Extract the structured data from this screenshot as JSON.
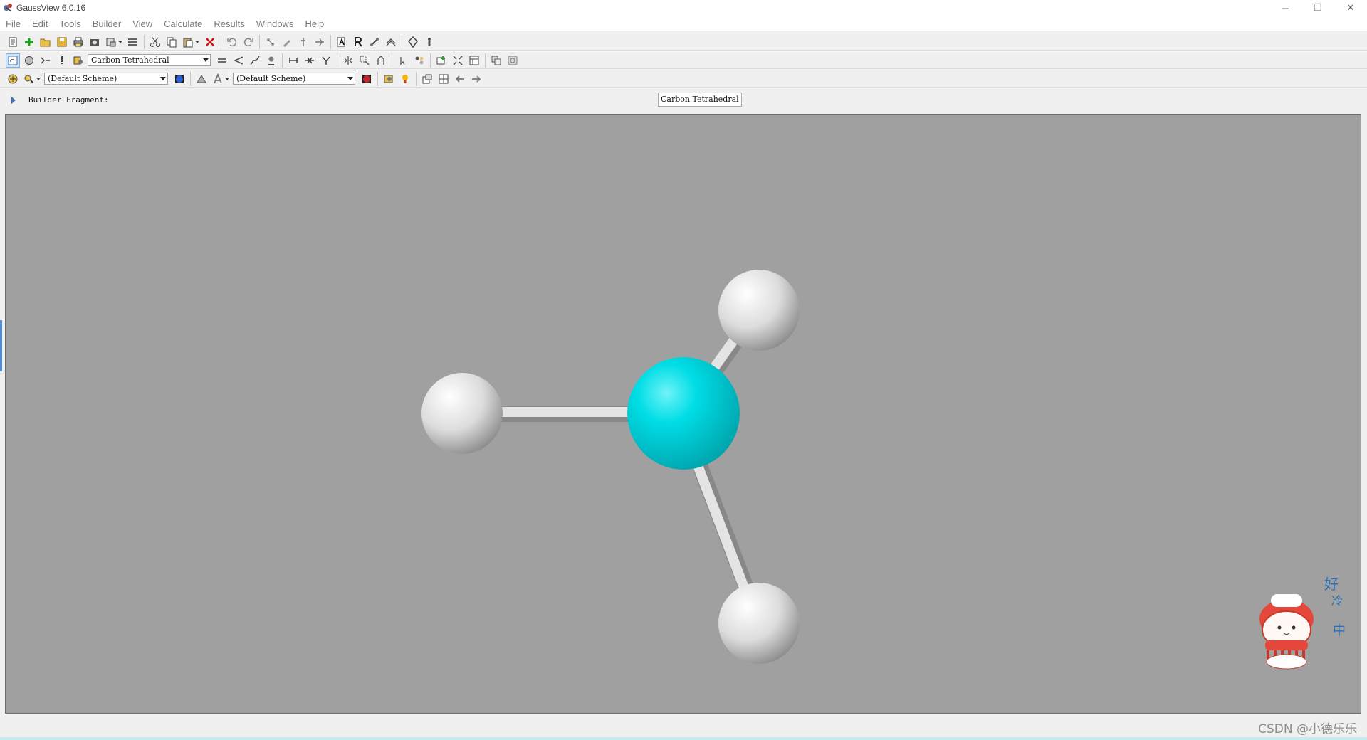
{
  "window": {
    "title": "GaussView 6.0.16",
    "controls": [
      "─",
      "❐",
      "✕"
    ]
  },
  "menu": [
    "File",
    "Edit",
    "Tools",
    "Builder",
    "View",
    "Calculate",
    "Results",
    "Windows",
    "Help"
  ],
  "toolbar2": {
    "fragment_combo": "Carbon Tetrahedral"
  },
  "toolbar3": {
    "scheme_combo_1": "(Default Scheme)",
    "scheme_combo_2": "(Default Scheme)"
  },
  "fragment_bar": {
    "label": "Builder Fragment:",
    "value": "Carbon Tetrahedral"
  },
  "molecule": {
    "central_atom": {
      "element": "C",
      "color": "#00d8e0"
    },
    "hydrogen_count": 3,
    "hydrogen_color": "#f0f0f0",
    "bond_color": "#d8d8d8"
  },
  "viewport_background": "#a0a0a0",
  "watermark": "CSDN @小德乐乐",
  "sticker": {
    "text": [
      "好",
      "冷",
      "中"
    ]
  }
}
